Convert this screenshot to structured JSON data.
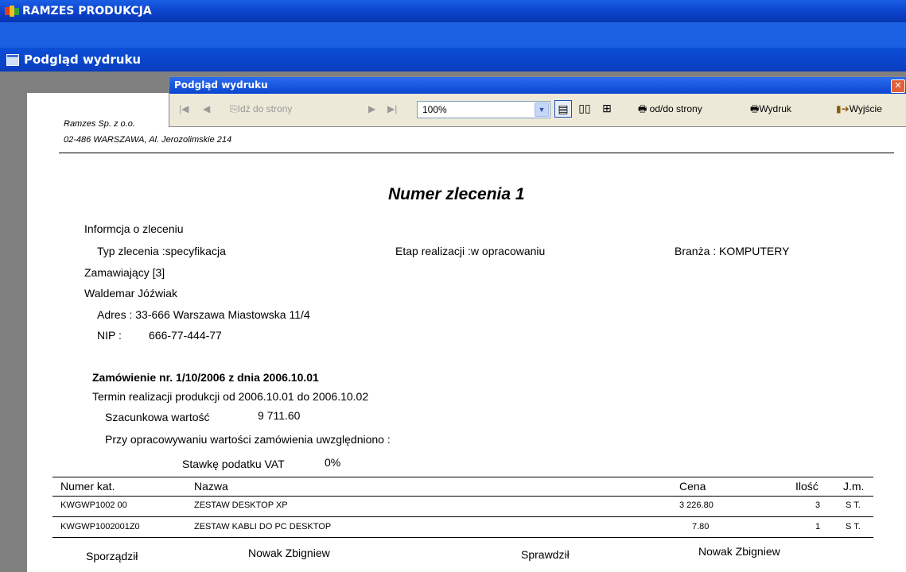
{
  "app": {
    "title": "RAMZES PRODUKCJA"
  },
  "window": {
    "title": "Podgląd wydruku"
  },
  "preview_toolbar": {
    "title": "Podgląd wydruku",
    "close_glyph": "✕",
    "goto_label": "Idź do strony",
    "zoom_value": "100%",
    "range_label": "od/do strony",
    "print_label": "Wydruk",
    "exit_label": "Wyjście"
  },
  "document": {
    "company_name": "Ramzes Sp. z o.o.",
    "company_address": "02-486 WARSZAWA, Al. Jerozolimskie 214",
    "heading": "Numer zlecenia 1",
    "order_info_label": "Informcja o zleceniu",
    "order_type": "Typ zlecenia :specyfikacja",
    "stage": "Etap realizacji :w opracowaniu",
    "industry": "Branża : KOMPUTERY",
    "client_label": "Zamawiający  [3]",
    "client_name": "Waldemar Jóźwiak",
    "address": "Adres : 33-666 Warszawa Miastowska 11/4",
    "nip_label": "NIP :",
    "nip_value": "666-77-444-77",
    "order_title": "Zamówienie nr.  1/10/2006 z dnia 2006.10.01",
    "term": "Termin realizacji produkcji od 2006.10.01  do 2006.10.02",
    "estimate_label": "Szacunkowa wartość",
    "estimate_value": "9 711.60",
    "considered": "Przy opracowywaniu wartości zamówienia uwzględniono :",
    "vat_label": "Stawkę podatku VAT",
    "vat_value": "0%",
    "table_headers": {
      "code": "Numer kat.",
      "name": "Nazwa",
      "price": "Cena",
      "qty": "Ilość",
      "unit": "J.m."
    },
    "rows": [
      {
        "code": "KWGWP1002  00",
        "name": "ZESTAW DESKTOP XP",
        "price": "3 226.80",
        "qty": "3",
        "unit": "S T."
      },
      {
        "code": "KWGWP1002001Z0",
        "name": "ZESTAW KABLI DO PC DESKTOP",
        "price": "7.80",
        "qty": "1",
        "unit": "S T."
      }
    ],
    "prepared_label": "Sporządził",
    "prepared_name": "Nowak Zbigniew",
    "checked_label": "Sprawdził",
    "checked_name": "Nowak Zbigniew"
  }
}
